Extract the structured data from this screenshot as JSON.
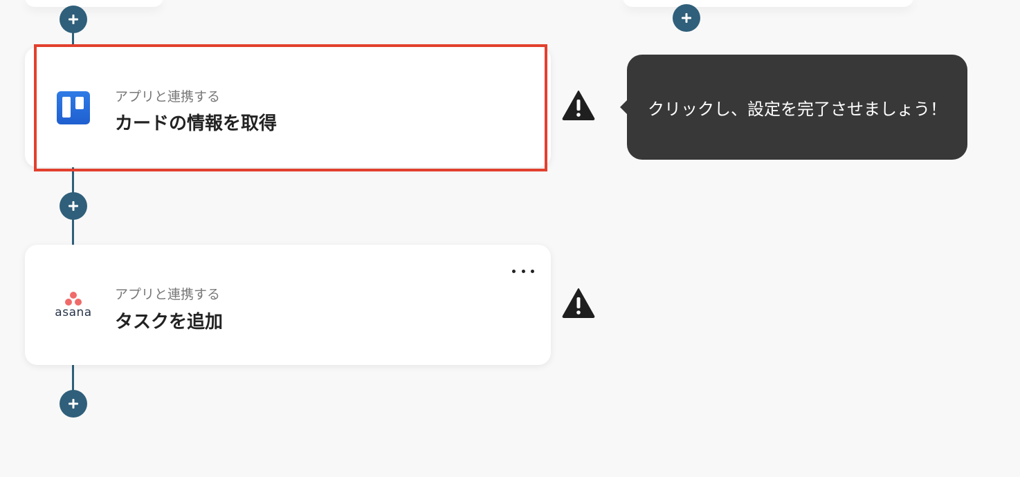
{
  "flow": {
    "steps": [
      {
        "subtitle": "アプリと連携する",
        "title": "カードの情報を取得",
        "app_icon": "trello-logo",
        "status_icon": "warning-icon",
        "highlighted": true
      },
      {
        "subtitle": "アプリと連携する",
        "title": "タスクを追加",
        "app_icon": "asana-logo",
        "app_logo_text": "asana",
        "status_icon": "warning-icon",
        "more_icon": "more-icon"
      }
    ],
    "add_step_icon": "plus-icon"
  },
  "tooltip": {
    "text": "クリックし、設定を完了させましょう！"
  },
  "colors": {
    "connector": "#2f5f7a",
    "highlight_border": "#e2402e",
    "tooltip_bg": "#383838",
    "trello_blue": "#2f7be6",
    "asana_coral": "#f06a6a"
  }
}
